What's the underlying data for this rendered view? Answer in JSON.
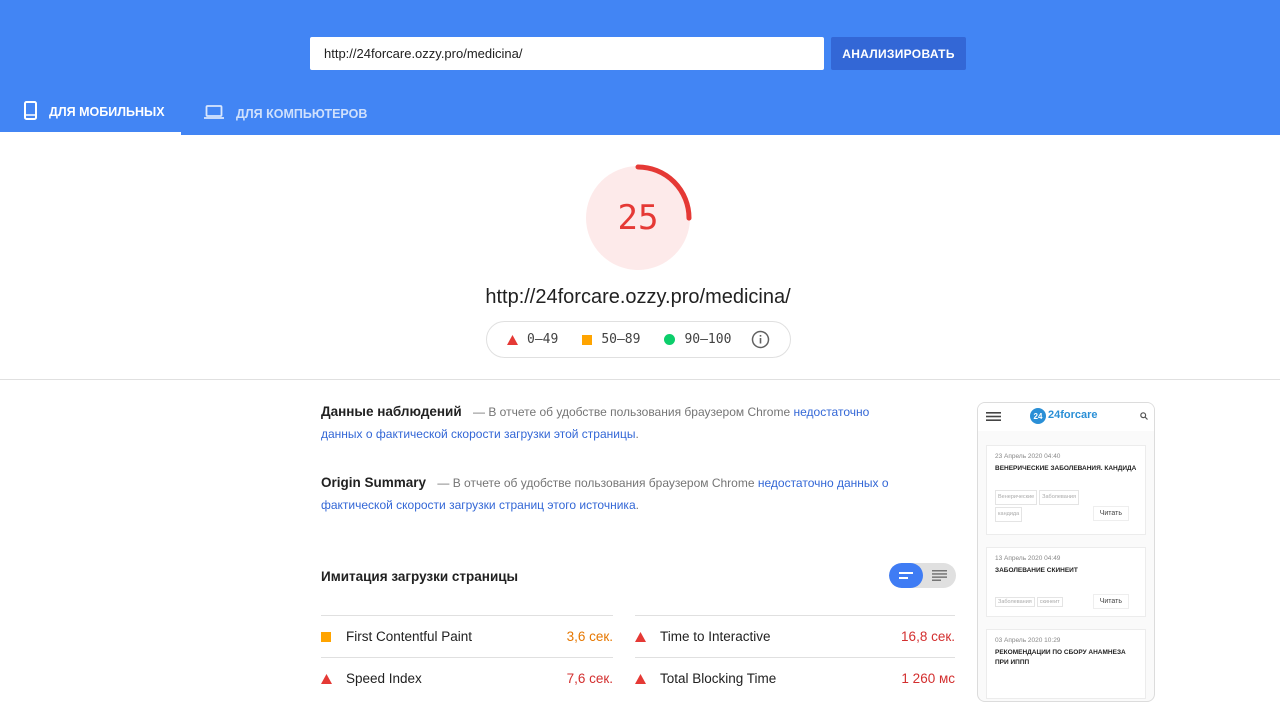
{
  "search": {
    "value": "http://24forcare.ozzy.pro/medicina/",
    "button_label": "АНАЛИЗИРОВАТЬ"
  },
  "tabs": [
    {
      "label": "ДЛЯ МОБИЛЬНЫХ",
      "icon": "phone-icon",
      "active": true
    },
    {
      "label": "ДЛЯ КОМПЬЮТЕРОВ",
      "icon": "laptop-icon",
      "active": false
    }
  ],
  "score": {
    "value": "25",
    "fraction": 0.25,
    "color": "#e53935"
  },
  "page_url": "http://24forcare.ozzy.pro/medicina/",
  "legend": [
    {
      "range": "0–49",
      "color": "#e53935",
      "shape": "triangle"
    },
    {
      "range": "50–89",
      "color": "#ffa400",
      "shape": "square"
    },
    {
      "range": "90–100",
      "color": "#0cce6b",
      "shape": "circle"
    }
  ],
  "field_data": {
    "title": "Данные наблюдений",
    "text": "— В отчете об удобстве пользования браузером Chrome",
    "link": "недостаточно данных о фактической скорости загрузки этой страницы",
    "end": "."
  },
  "origin_summary": {
    "title": "Origin Summary",
    "text": "— В отчете об удобстве пользования браузером Chrome",
    "link": "недостаточно данных о фактической скорости загрузки страниц этого источника",
    "end": "."
  },
  "lab": {
    "title": "Имитация загрузки страницы",
    "metrics": [
      {
        "name": "First Contentful Paint",
        "value": "3,6 сек.",
        "status": "average"
      },
      {
        "name": "Time to Interactive",
        "value": "16,8 сек.",
        "status": "fail"
      },
      {
        "name": "Speed Index",
        "value": "7,6 сек.",
        "status": "fail"
      },
      {
        "name": "Total Blocking Time",
        "value": "1 260 мс",
        "status": "fail"
      }
    ]
  },
  "preview": {
    "logo_text": "24forcare",
    "logo_badge": "24",
    "cards": [
      {
        "date": "23 Апрель 2020   04:40",
        "title": "ВЕНЕРИЧЕСКИЕ ЗАБОЛЕВАНИЯ. КАНДИДА",
        "tags": [
          "Венерические",
          "Заболевания",
          "кандида"
        ],
        "button": "Читать"
      },
      {
        "date": "13 Апрель 2020   04:49",
        "title": "ЗАБОЛЕВАНИЕ СКИНЕИТ",
        "tags": [
          "Заболевания",
          "скинеит"
        ],
        "button": "Читать"
      },
      {
        "date": "03 Апрель 2020   10:29",
        "title": "РЕКОМЕНДАЦИИ ПО СБОРУ АНАМНЕЗА ПРИ ИППП",
        "tags": [],
        "button": ""
      }
    ]
  }
}
